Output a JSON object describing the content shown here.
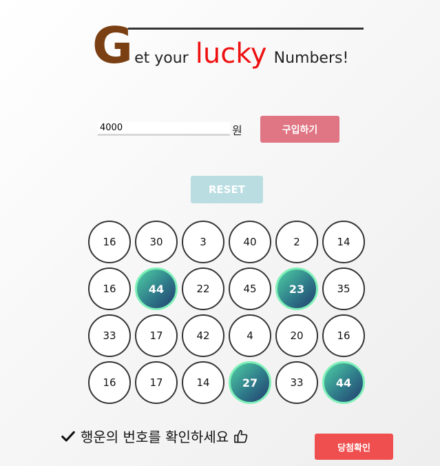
{
  "header": {
    "title_g": "G",
    "title_part1": "et your",
    "title_lucky": "lucky",
    "title_part2": "Numbers!"
  },
  "purchase": {
    "amount_value": "4000",
    "currency": "원",
    "buy_label": "구입하기"
  },
  "reset_label": "RESET",
  "lotto": {
    "rows": [
      [
        {
          "n": "16",
          "w": false
        },
        {
          "n": "30",
          "w": false
        },
        {
          "n": "3",
          "w": false
        },
        {
          "n": "40",
          "w": false
        },
        {
          "n": "2",
          "w": false
        },
        {
          "n": "14",
          "w": false
        }
      ],
      [
        {
          "n": "16",
          "w": false
        },
        {
          "n": "44",
          "w": true
        },
        {
          "n": "22",
          "w": false
        },
        {
          "n": "45",
          "w": false
        },
        {
          "n": "23",
          "w": true
        },
        {
          "n": "35",
          "w": false
        }
      ],
      [
        {
          "n": "33",
          "w": false
        },
        {
          "n": "17",
          "w": false
        },
        {
          "n": "42",
          "w": false
        },
        {
          "n": "4",
          "w": false
        },
        {
          "n": "20",
          "w": false
        },
        {
          "n": "16",
          "w": false
        }
      ],
      [
        {
          "n": "16",
          "w": false
        },
        {
          "n": "17",
          "w": false
        },
        {
          "n": "14",
          "w": false
        },
        {
          "n": "27",
          "w": true
        },
        {
          "n": "33",
          "w": false
        },
        {
          "n": "44",
          "w": true
        }
      ]
    ]
  },
  "footer": {
    "message": "행운의 번호를 확인하세요",
    "check_label": "당첨확인",
    "icons": [
      "check-icon",
      "thumbs-up-icon"
    ]
  },
  "colors": {
    "title_g": "#7a3f12",
    "lucky": "#ee1111",
    "buy_button": "#e07584",
    "reset_button": "#b9dde1",
    "check_button": "#f04f4f",
    "win_ball_gradient": [
      "#4fd0a4",
      "#2f7b8a",
      "#233e6e"
    ],
    "win_ball_border": "#7ff0b8"
  }
}
